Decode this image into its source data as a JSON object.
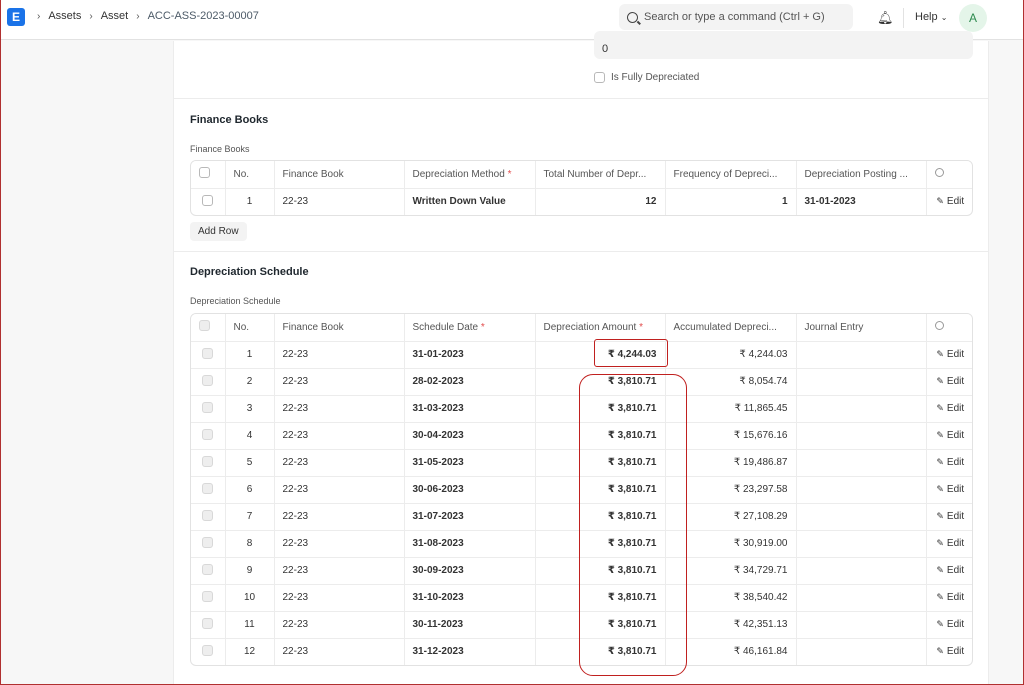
{
  "navbar": {
    "logo": "E",
    "breadcrumbs": [
      "Assets",
      "Asset",
      "ACC-ASS-2023-00007"
    ],
    "search_placeholder": "Search or type a command (Ctrl + G)",
    "help_label": "Help",
    "avatar_initial": "A"
  },
  "top_field": {
    "value": "0"
  },
  "fully_depreciated": {
    "label": "Is Fully Depreciated",
    "checked": false
  },
  "finance_books": {
    "title": "Finance Books",
    "table_label": "Finance Books",
    "columns": [
      "No.",
      "Finance Book",
      "Depreciation Method",
      "Total Number of Depr...",
      "Frequency of Depreci...",
      "Depreciation Posting ..."
    ],
    "rows": [
      {
        "no": "1",
        "finance_book": "22-23",
        "method": "Written Down Value",
        "total": "12",
        "frequency": "1",
        "posting": "31-01-2023",
        "edit": "Edit"
      }
    ],
    "add_row_label": "Add Row"
  },
  "depreciation_schedule": {
    "title": "Depreciation Schedule",
    "table_label": "Depreciation Schedule",
    "columns": [
      "No.",
      "Finance Book",
      "Schedule Date",
      "Depreciation Amount",
      "Accumulated Depreci...",
      "Journal Entry"
    ],
    "rows": [
      {
        "no": "1",
        "finance_book": "22-23",
        "date": "31-01-2023",
        "amount": "₹ 4,244.03",
        "accumulated": "₹ 4,244.03",
        "journal": "",
        "edit": "Edit"
      },
      {
        "no": "2",
        "finance_book": "22-23",
        "date": "28-02-2023",
        "amount": "₹ 3,810.71",
        "accumulated": "₹ 8,054.74",
        "journal": "",
        "edit": "Edit"
      },
      {
        "no": "3",
        "finance_book": "22-23",
        "date": "31-03-2023",
        "amount": "₹ 3,810.71",
        "accumulated": "₹ 11,865.45",
        "journal": "",
        "edit": "Edit"
      },
      {
        "no": "4",
        "finance_book": "22-23",
        "date": "30-04-2023",
        "amount": "₹ 3,810.71",
        "accumulated": "₹ 15,676.16",
        "journal": "",
        "edit": "Edit"
      },
      {
        "no": "5",
        "finance_book": "22-23",
        "date": "31-05-2023",
        "amount": "₹ 3,810.71",
        "accumulated": "₹ 19,486.87",
        "journal": "",
        "edit": "Edit"
      },
      {
        "no": "6",
        "finance_book": "22-23",
        "date": "30-06-2023",
        "amount": "₹ 3,810.71",
        "accumulated": "₹ 23,297.58",
        "journal": "",
        "edit": "Edit"
      },
      {
        "no": "7",
        "finance_book": "22-23",
        "date": "31-07-2023",
        "amount": "₹ 3,810.71",
        "accumulated": "₹ 27,108.29",
        "journal": "",
        "edit": "Edit"
      },
      {
        "no": "8",
        "finance_book": "22-23",
        "date": "31-08-2023",
        "amount": "₹ 3,810.71",
        "accumulated": "₹ 30,919.00",
        "journal": "",
        "edit": "Edit"
      },
      {
        "no": "9",
        "finance_book": "22-23",
        "date": "30-09-2023",
        "amount": "₹ 3,810.71",
        "accumulated": "₹ 34,729.71",
        "journal": "",
        "edit": "Edit"
      },
      {
        "no": "10",
        "finance_book": "22-23",
        "date": "31-10-2023",
        "amount": "₹ 3,810.71",
        "accumulated": "₹ 38,540.42",
        "journal": "",
        "edit": "Edit"
      },
      {
        "no": "11",
        "finance_book": "22-23",
        "date": "30-11-2023",
        "amount": "₹ 3,810.71",
        "accumulated": "₹ 42,351.13",
        "journal": "",
        "edit": "Edit"
      },
      {
        "no": "12",
        "finance_book": "22-23",
        "date": "31-12-2023",
        "amount": "₹ 3,810.71",
        "accumulated": "₹ 46,161.84",
        "journal": "",
        "edit": "Edit"
      }
    ]
  },
  "colors": {
    "brand": "#1a73e8",
    "required": "#e24c4c",
    "annotation": "#c0201f"
  }
}
